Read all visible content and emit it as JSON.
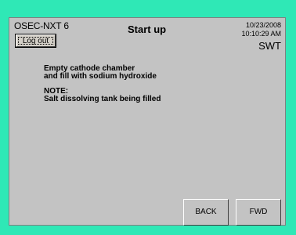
{
  "header": {
    "app_name": "OSEC-NXT 6",
    "title": "Start up",
    "date": "10/23/2008",
    "time": "10:10:29 AM",
    "shift": "SWT",
    "logout_label": "Log out"
  },
  "message": {
    "line1": "Empty cathode chamber",
    "line2": "and fill with sodium hydroxide",
    "note_label": "NOTE:",
    "note_text": "Salt dissolving tank being filled"
  },
  "nav": {
    "back_label": "BACK",
    "fwd_label": "FWD"
  },
  "colors": {
    "background": "#2fe8b6",
    "panel": "#c3c3c3"
  }
}
